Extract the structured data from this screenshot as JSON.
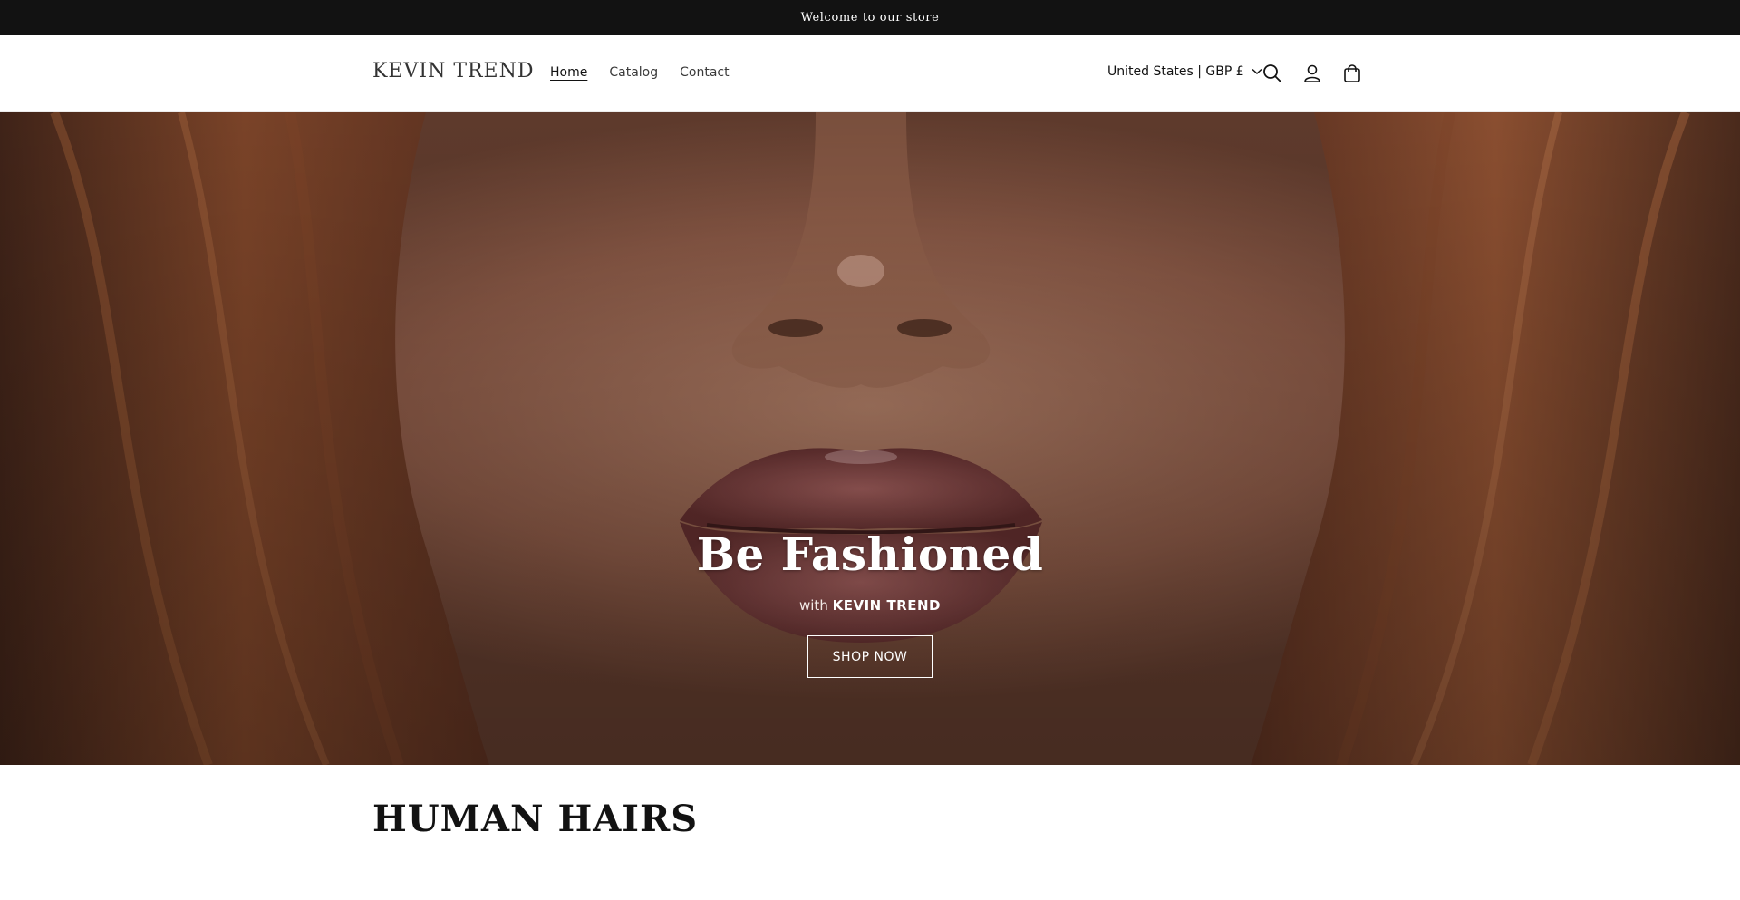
{
  "announcement": {
    "text": "Welcome to our store"
  },
  "header": {
    "logo": "KEVIN TREND",
    "nav": [
      {
        "label": "Home",
        "active": true
      },
      {
        "label": "Catalog",
        "active": false
      },
      {
        "label": "Contact",
        "active": false
      }
    ],
    "locale": "United States | GBP £",
    "icons": [
      "search-icon",
      "account-icon",
      "cart-icon"
    ]
  },
  "hero": {
    "title": "Be Fashioned",
    "subtitle_prefix": "with",
    "subtitle_brand": "KEVIN TREND",
    "button_label": "SHOP NOW"
  },
  "collection": {
    "title": "HUMAN HAIRS"
  },
  "colors": {
    "announcement_bg": "#121212",
    "hero_skin": "#8a5a45",
    "hero_hair": "#5a3020",
    "lips": "#7a3c3c"
  }
}
